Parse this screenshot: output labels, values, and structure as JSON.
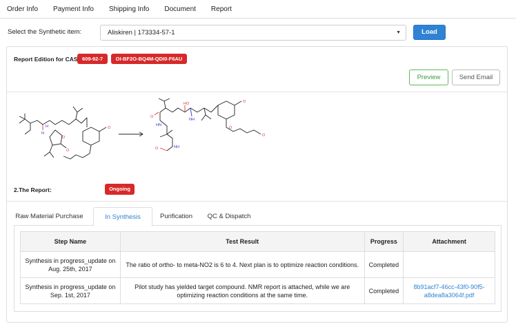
{
  "nav": {
    "items": [
      "Order Info",
      "Payment Info",
      "Shipping Info",
      "Document",
      "Report"
    ]
  },
  "select": {
    "label": "Select the Synthetic item:",
    "value": "Aliskiren | 173334-57-1",
    "load_label": "Load"
  },
  "report": {
    "edition_label": "Report Edition for CAS:",
    "cas_badge": "609-92-7",
    "code_badge": "OI-BF2O-BQ4M-QDI0-F6AU",
    "preview_label": "Preview",
    "send_email_label": "Send Email",
    "section_label": "2.The Report:",
    "status_badge": "Ongoing"
  },
  "tabs": [
    "Raw Material Purchase",
    "In Synthesis",
    "Purification",
    "QC & Dispatch"
  ],
  "table": {
    "headers": [
      "Step Name",
      "Test Result",
      "Progress",
      "Attachment"
    ],
    "rows": [
      {
        "step": "Synthesis in progress_update on Aug. 25th, 2017",
        "result": "The ratio of ortho- to meta-NO2 is 6 to 4. Next plan is  to optimize reaction conditions.",
        "progress": "Completed",
        "attachment": ""
      },
      {
        "step": "Synthesis in progress_update on Sep. 1st, 2017",
        "result": "Pilot study has yielded target compound. NMR report is attached, while we are optimizing reaction conditions at the same time.",
        "progress": "Completed",
        "attachment": "8b91acf7-46cc-43f0-90f5-a8dea8a3064f.pdf"
      }
    ]
  },
  "colors": {
    "primary": "#2f83d4",
    "danger": "#d62a2a",
    "success": "#5cb85c"
  }
}
